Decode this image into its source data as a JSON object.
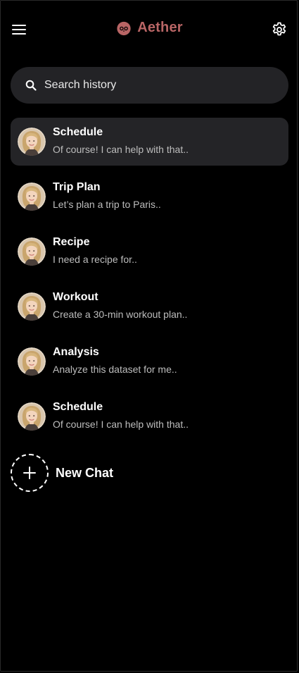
{
  "header": {
    "menu_icon": "hamburger-menu-icon",
    "brand_name": "Aether",
    "brand_icon": "owl-logo-icon",
    "settings_icon": "gear-icon"
  },
  "colors": {
    "background": "#000000",
    "brand": "#b86565",
    "surface": "#232326",
    "text_primary": "#ffffff",
    "text_secondary": "#bdbdbd"
  },
  "search": {
    "placeholder": "Search history",
    "value": "",
    "icon": "search-icon"
  },
  "chats": [
    {
      "title": "Schedule",
      "preview": "Of course! I can help with that..",
      "active": true
    },
    {
      "title": "Trip Plan",
      "preview": "Let’s plan a trip to Paris..",
      "active": false
    },
    {
      "title": "Recipe",
      "preview": "I need a recipe for..",
      "active": false
    },
    {
      "title": "Workout",
      "preview": "Create a 30-min workout plan..",
      "active": false
    },
    {
      "title": "Analysis",
      "preview": "Analyze this dataset for me..",
      "active": false
    },
    {
      "title": "Schedule",
      "preview": "Of course! I can help with that..",
      "active": false
    }
  ],
  "new_chat": {
    "label": "New Chat",
    "icon": "plus-icon"
  }
}
